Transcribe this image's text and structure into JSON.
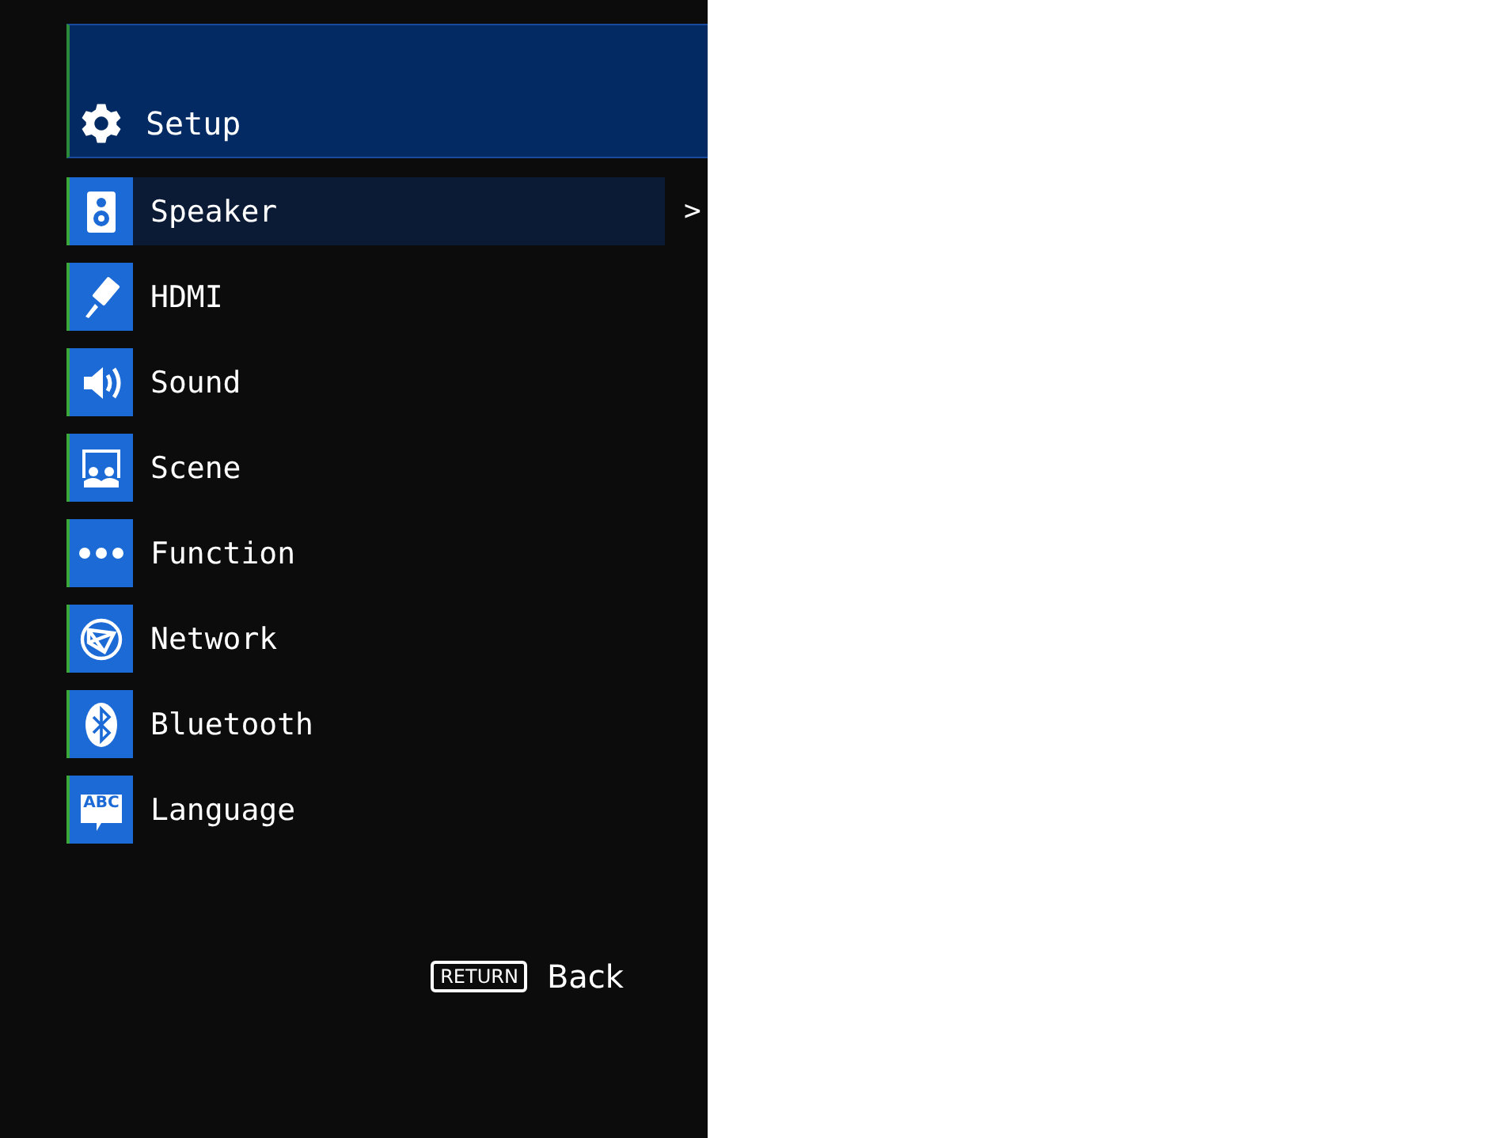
{
  "header": {
    "title": "Setup"
  },
  "menu": [
    {
      "label": "Speaker",
      "kind": "speaker",
      "selected": true,
      "arrow": ">"
    },
    {
      "label": "HDMI",
      "kind": "hdmi",
      "selected": false
    },
    {
      "label": "Sound",
      "kind": "sound",
      "selected": false
    },
    {
      "label": "Scene",
      "kind": "scene",
      "selected": false
    },
    {
      "label": "Function",
      "kind": "function",
      "selected": false
    },
    {
      "label": "Network",
      "kind": "network",
      "selected": false
    },
    {
      "label": "Bluetooth",
      "kind": "bluetooth",
      "selected": false
    },
    {
      "label": "Language",
      "kind": "language",
      "icon_text": "ABC",
      "selected": false
    }
  ],
  "footer": {
    "key": "RETURN",
    "label": "Back"
  }
}
